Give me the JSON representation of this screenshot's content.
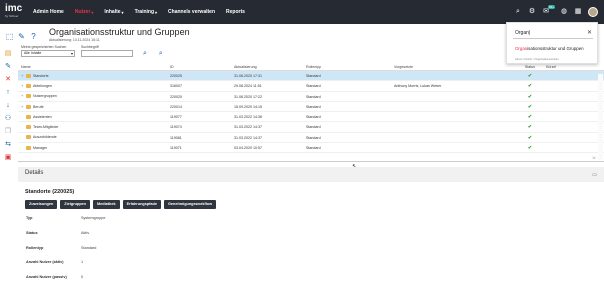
{
  "brand": {
    "logo": "imc",
    "sub": "by Scheer"
  },
  "nav": {
    "items": [
      {
        "label": "Admin Home",
        "active": false,
        "dropdown": false
      },
      {
        "label": "Nutzer",
        "active": true,
        "dropdown": true
      },
      {
        "label": "Inhalte",
        "active": false,
        "dropdown": true
      },
      {
        "label": "Training",
        "active": false,
        "dropdown": true
      },
      {
        "label": "Channels verwalten",
        "active": false,
        "dropdown": false
      },
      {
        "label": "Reports",
        "active": false,
        "dropdown": false
      }
    ],
    "badge": "99+"
  },
  "page": {
    "title": "Organisationsstruktur und Gruppen",
    "subtitle": "Aktualisierung: 13.11.2024 16:11"
  },
  "filters": {
    "saved_label": "Meine gespeicherten Suchen",
    "saved_value": "Alle Inhalte",
    "term_label": "Suchbegriff",
    "term_value": ""
  },
  "grid": {
    "columns": [
      "Name",
      "ID",
      "Aktualisierung",
      "Rollentyp",
      "Vorgesetzte",
      "Status",
      "Kürzel"
    ],
    "rows": [
      {
        "name": "Standorte",
        "id": "220025",
        "updated": "31.08.2020 17:31",
        "role": "Standard",
        "boss": "",
        "selected": true,
        "tw": "+"
      },
      {
        "name": "Abteilungen",
        "id": "316007",
        "updated": "29.08.2024 11:51",
        "role": "Standard",
        "boss": "Anthony Morris; Lukas Weber",
        "selected": false,
        "tw": "+"
      },
      {
        "name": "Nutzergruppen",
        "id": "220020",
        "updated": "31.08.2020 17:22",
        "role": "Standard",
        "boss": "",
        "selected": false,
        "tw": "+"
      },
      {
        "name": "Berufe",
        "id": "220014",
        "updated": "15.09.2020 14:15",
        "role": "Standard",
        "boss": "",
        "selected": false,
        "tw": "+"
      },
      {
        "name": "Assistenten",
        "id": "119077",
        "updated": "31.03.2022 14:36",
        "role": "Standard",
        "boss": "",
        "selected": false,
        "tw": ""
      },
      {
        "name": "Team-Mitglieder",
        "id": "119074",
        "updated": "31.03.2022 14:37",
        "role": "Standard",
        "boss": "",
        "selected": false,
        "tw": ""
      },
      {
        "name": "Auszubildende",
        "id": "119081",
        "updated": "31.03.2022 14:37",
        "role": "Standard",
        "boss": "",
        "selected": false,
        "tw": ""
      },
      {
        "name": "Manager",
        "id": "119071",
        "updated": "03.04.2020 10:57",
        "role": "Standard",
        "boss": "",
        "selected": false,
        "tw": ""
      }
    ]
  },
  "details": {
    "bar_title": "Details",
    "record_title": "Standorte (220025)",
    "buttons": [
      "Zuweisungen",
      "Zielgruppen",
      "Mediathek",
      "Erfahrungspfade",
      "Genehmigungsworkflow"
    ],
    "props": [
      {
        "k": "Typ",
        "v": "Systemgruppe"
      },
      {
        "k": "Status",
        "v": "Aktiv"
      },
      {
        "k": "Rollentyp",
        "v": "Standard"
      },
      {
        "k": "Anzahl Nutzer (aktiv)",
        "v": "1"
      },
      {
        "k": "Anzahl Nutzer (passiv)",
        "v": "0"
      }
    ]
  },
  "search_popup": {
    "query": "Organ|",
    "result_highlight": "Organ",
    "result_rest": "isationsstruktur und Gruppen",
    "path": "Admin / Nutzer / Organisationsstruktur"
  },
  "colors": {
    "accent": "#e8334a",
    "topbar": "#262a33",
    "selected_row": "#cfe6f7",
    "status_ok": "#3a9c3a"
  },
  "icons": [
    "search-icon",
    "gear-icon",
    "notifications-icon",
    "globe-icon",
    "apps-grid-icon",
    "user-avatar",
    "close-icon",
    "folder-icon",
    "check-icon"
  ]
}
